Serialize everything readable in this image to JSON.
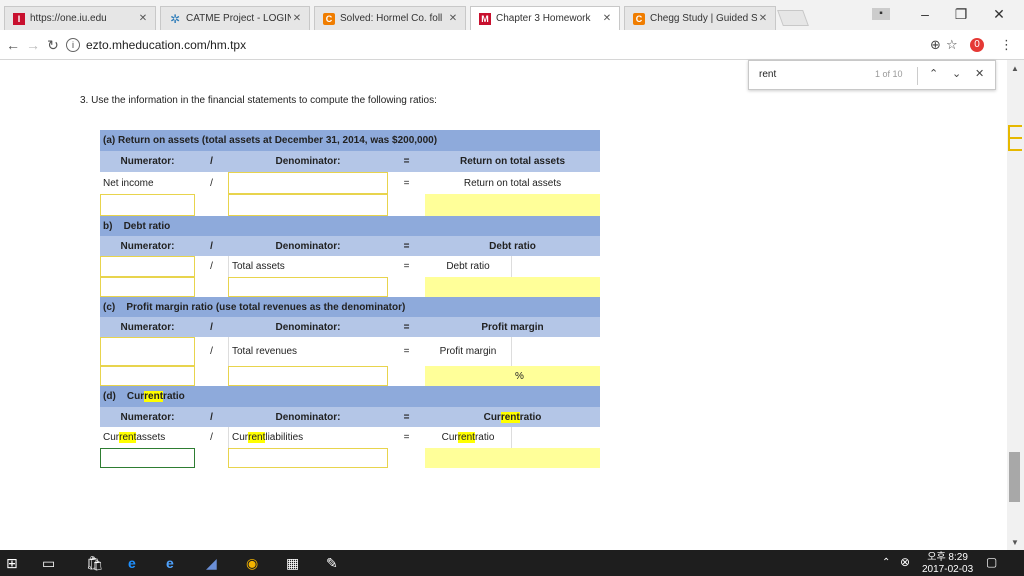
{
  "browser": {
    "tabs": [
      {
        "title": "https://one.iu.edu",
        "favicon": "iu-icon",
        "color": "#c8102e",
        "active": false
      },
      {
        "title": "CATME Project - LOGIN",
        "favicon": "catme-icon",
        "color": "#2a7ab8",
        "active": false
      },
      {
        "title": "Solved: Hormel Co. foll",
        "favicon": "chegg-icon",
        "color": "#f07d00",
        "active": false
      },
      {
        "title": "Chapter 3 Homework",
        "favicon": "mheducation-icon",
        "color": "#c8102e",
        "active": true
      },
      {
        "title": "Chegg Study | Guided S",
        "favicon": "chegg-icon",
        "color": "#f07d00",
        "active": false
      }
    ],
    "url": "ezto.mheducation.com/hm.tpx",
    "find": {
      "query": "rent",
      "count": "1 of 10"
    }
  },
  "question": "3.  Use the information in the financial statements to compute the following ratios:",
  "sections": {
    "a": {
      "title": "(a) Return on assets (total assets at December 31, 2014, was $200,000)",
      "numerator": "Numerator:",
      "slash": "/",
      "denominator": "Denominator:",
      "equals": "=",
      "result": "Return on total assets",
      "row_numerator": "Net income",
      "row_result": "Return on total assets"
    },
    "b": {
      "label": "b)",
      "title": "Debt ratio",
      "numerator": "Numerator:",
      "slash": "/",
      "denominator": "Denominator:",
      "equals": "=",
      "result": "Debt ratio",
      "row_denominator": "Total assets",
      "row_result": "Debt ratio"
    },
    "c": {
      "label": "(c)",
      "title": "Profit margin ratio (use total revenues as the denominator)",
      "numerator": "Numerator:",
      "slash": "/",
      "denominator": "Denominator:",
      "equals": "=",
      "result": "Profit margin",
      "row_denominator": "Total revenues",
      "row_result": "Profit margin",
      "percent": "%"
    },
    "d": {
      "label": "(d)",
      "title_hl": "Cur",
      "title_mid": "rent",
      "title_rest": " ratio",
      "numerator": "Numerator:",
      "slash": "/",
      "denominator": "Denominator:",
      "equals": "=",
      "result_a": "Cur",
      "result_b": "rent",
      "result_c": " ratio",
      "num_a": "Cur",
      "num_b": "rent",
      "num_c": " assets",
      "den_a": "Cur",
      "den_b": "rent",
      "den_c": " liabilities",
      "res_a": "Cur",
      "res_b": "rent",
      "res_c": " ratio"
    }
  },
  "taskbar": {
    "time": "오후 8:29",
    "date": "2017-02-03"
  }
}
